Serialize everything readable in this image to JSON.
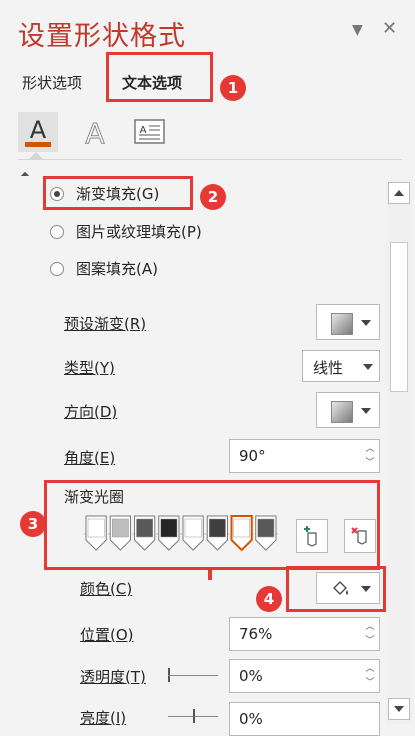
{
  "pane": {
    "title": "设置形状格式",
    "tabs": [
      {
        "label": "形状选项"
      },
      {
        "label": "文本选项"
      }
    ]
  },
  "icons": [
    "text-fill-outline-icon",
    "text-effects-icon",
    "textbox-icon"
  ],
  "fill_options": [
    {
      "label": "渐变填充(G)",
      "selected": true
    },
    {
      "label": "图片或纹理填充(P)",
      "selected": false
    },
    {
      "label": "图案填充(A)",
      "selected": false
    }
  ],
  "settings": {
    "preset_gradient_label": "预设渐变(R)",
    "type_label": "类型(Y)",
    "type_value": "线性",
    "direction_label": "方向(D)",
    "angle_label": "角度(E)",
    "angle_value": "90°",
    "gradient_stops_label": "渐变光圈",
    "color_label": "颜色(C)",
    "position_label": "位置(O)",
    "position_value": "76%",
    "transparency_label": "透明度(T)",
    "transparency_value": "0%",
    "brightness_label": "亮度(I)",
    "brightness_value": "0%"
  },
  "gradient_stops": [
    {
      "color": "#ffffff",
      "selected": false
    },
    {
      "color": "#bdbdbd",
      "selected": false
    },
    {
      "color": "#595959",
      "selected": false
    },
    {
      "color": "#262626",
      "selected": false
    },
    {
      "color": "#ffffff",
      "selected": false
    },
    {
      "color": "#3f3f3f",
      "selected": false
    },
    {
      "color": "#ffffff",
      "selected": true
    },
    {
      "color": "#595959",
      "selected": false
    }
  ],
  "annotations": [
    "1",
    "2",
    "3",
    "4"
  ],
  "colors": {
    "accent": "#c0392b",
    "highlight": "#e53935",
    "selected_stop": "#d35400"
  }
}
